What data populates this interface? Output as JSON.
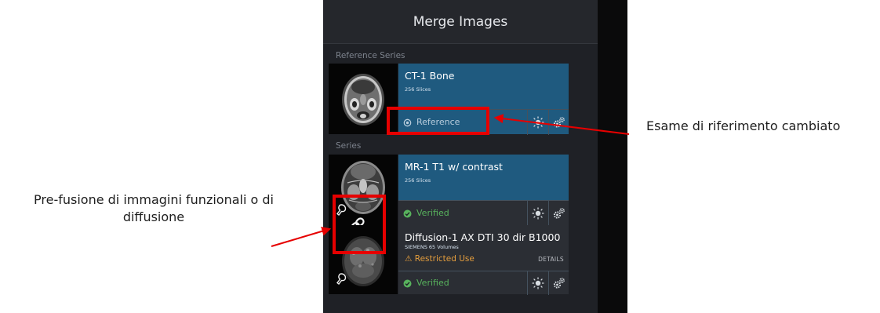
{
  "panel": {
    "title": "Merge Images"
  },
  "sections": {
    "reference": "Reference Series",
    "series": "Series"
  },
  "reference_series": {
    "name": "CT-1 Bone",
    "slices": "256 Slices",
    "status": "Reference"
  },
  "series": [
    {
      "name": "MR-1 T1 w/ contrast",
      "slices": "256 Slices",
      "status": "Verified"
    },
    {
      "name": "Diffusion-1 AX DTI 30 dir B1000",
      "slices": "SIEMENS 65 Volumes",
      "warning": "Restricted Use",
      "details": "DETAILS",
      "status": "Verified"
    }
  ],
  "callouts": {
    "reference_changed": "Esame di riferimento cambiato",
    "prefusion": "Pre-fusione di immagini funzionali o di diffusione"
  },
  "colors": {
    "panel_bg": "#1f2126",
    "selected_row": "#1f5a7f",
    "verified_green": "#58b35d",
    "warning_orange": "#e59e3d",
    "highlight_red": "#e60000"
  },
  "icons": [
    "reference-circle-icon",
    "sun-icon",
    "gear-icon",
    "check-circle-icon",
    "warning-icon",
    "link-icon",
    "probe-icon"
  ]
}
